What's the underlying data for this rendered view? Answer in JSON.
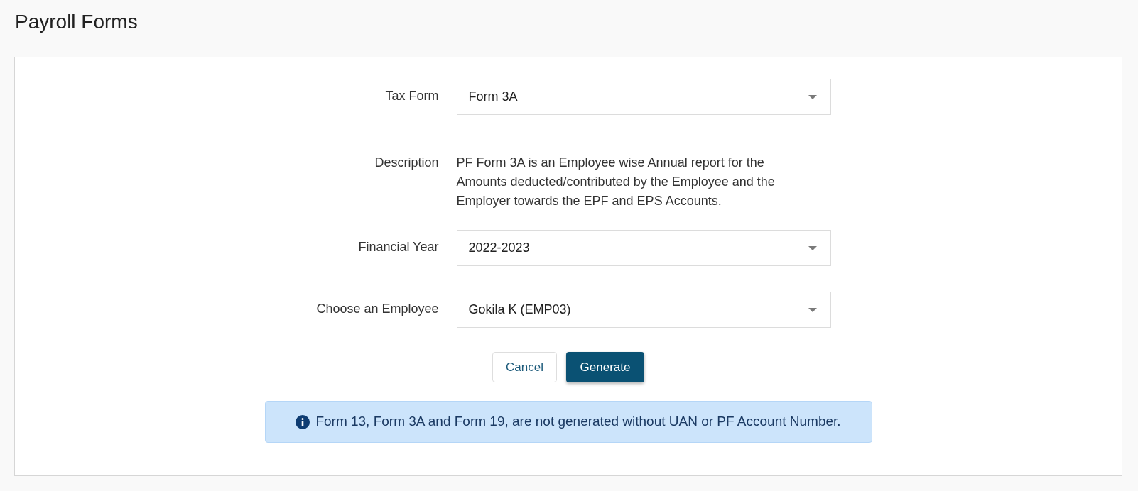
{
  "page": {
    "title": "Payroll Forms"
  },
  "form": {
    "fields": [
      {
        "kind": "select",
        "label": "Tax Form",
        "value": "Form 3A"
      },
      {
        "kind": "text",
        "label": "Description",
        "value": "PF Form 3A is an Employee wise Annual report for the Amounts deducted/contributed by the Employee and the Employer towards the EPF and EPS Accounts."
      },
      {
        "kind": "select",
        "label": "Financial Year",
        "value": "2022-2023"
      },
      {
        "kind": "select",
        "label": "Choose an Employee",
        "value": "Gokila K (EMP03)"
      }
    ],
    "buttons": [
      {
        "kind": "secondary",
        "label": "Cancel"
      },
      {
        "kind": "primary",
        "label": "Generate"
      }
    ]
  },
  "alert": {
    "kind": "info",
    "text": "Form 13, Form 3A and Form 19, are not generated without UAN or PF Account Number."
  }
}
